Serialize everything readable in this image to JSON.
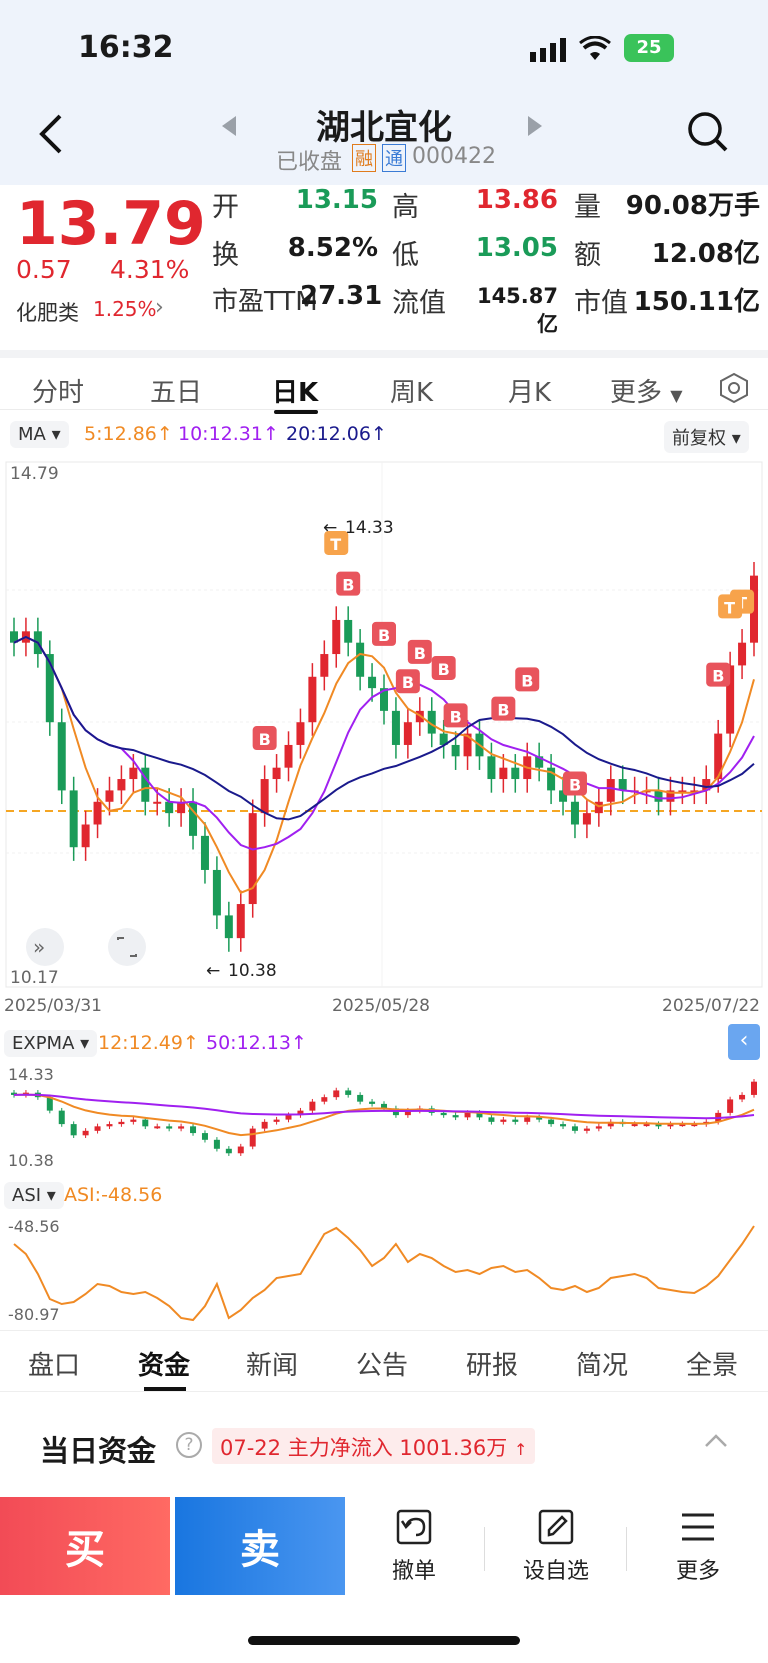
{
  "status_bar": {
    "time": "16:32",
    "battery": "25"
  },
  "header": {
    "title": "湖北宜化",
    "status": "已收盘",
    "badge_rong": "融",
    "badge_tong": "通",
    "code": "000422"
  },
  "quote": {
    "price": "13.79",
    "change": "0.57",
    "change_pct": "4.31%",
    "sector_name": "化肥类",
    "sector_pct": "1.25%",
    "stats": [
      {
        "label": "开",
        "value": "13.15"
      },
      {
        "label": "高",
        "value": "13.86"
      },
      {
        "label": "量",
        "value": "90.08万手"
      },
      {
        "label": "换",
        "value": "8.52%"
      },
      {
        "label": "低",
        "value": "13.05"
      },
      {
        "label": "额",
        "value": "12.08亿"
      },
      {
        "label": "市盈TTM",
        "value": "27.31"
      },
      {
        "label": "流值",
        "value": "145.87亿"
      },
      {
        "label": "市值",
        "value": "150.11亿"
      }
    ]
  },
  "chart_tabs": [
    "分时",
    "五日",
    "日K",
    "周K",
    "月K",
    "更多"
  ],
  "ma_bar": {
    "selector": "MA",
    "ma5": "5:12.86",
    "ma10": "10:12.31",
    "ma20": "20:12.06",
    "adjust": "前复权"
  },
  "kline": {
    "y_max_label": "14.79",
    "y_min_label": "10.17",
    "high_marker": "14.33",
    "low_marker": "10.38",
    "dates": [
      "2025/03/31",
      "2025/05/28",
      "2025/07/22"
    ],
    "b_label": "B",
    "t_label": "T"
  },
  "expma": {
    "selector": "EXPMA",
    "ema12": "12:12.49",
    "ema50": "50:12.13",
    "top_label": "14.33",
    "bottom_label": "10.38"
  },
  "asi": {
    "selector": "ASI",
    "value": "ASI:-48.56",
    "top_label": "-48.56",
    "bottom_label": "-80.97"
  },
  "bottom_tabs": [
    "盘口",
    "资金",
    "新闻",
    "公告",
    "研报",
    "简况",
    "全景"
  ],
  "funds": {
    "title": "当日资金",
    "date": "07-22",
    "text": "主力净流入",
    "amount": "1001.36万"
  },
  "actions": {
    "buy": "买",
    "sell": "卖",
    "cancel": "撤单",
    "watch": "设自选",
    "more": "更多"
  },
  "colors": {
    "up": "#e0272f",
    "down": "#1a9b58",
    "ma5": "#f08a24",
    "ma10": "#a020f0",
    "ma20": "#1a1a8c"
  },
  "chart_data": {
    "type": "candlestick",
    "title": "湖北宜化 日K",
    "dates": [
      "2025/03/31",
      "2025/05/28",
      "2025/07/22"
    ],
    "ylim": [
      10.17,
      14.79
    ],
    "high": 14.33,
    "low": 10.38,
    "last_close": 13.79,
    "series": [
      {
        "name": "MA5",
        "last": 12.86
      },
      {
        "name": "MA10",
        "last": 12.31
      },
      {
        "name": "MA20",
        "last": 12.06
      }
    ],
    "closes": [
      13.2,
      13.3,
      13.1,
      12.5,
      11.9,
      11.4,
      11.6,
      11.8,
      11.9,
      12.0,
      12.1,
      11.8,
      11.8,
      11.7,
      11.8,
      11.5,
      11.2,
      10.8,
      10.6,
      10.9,
      11.7,
      12.0,
      12.1,
      12.3,
      12.5,
      12.9,
      13.1,
      13.4,
      13.2,
      12.9,
      12.8,
      12.6,
      12.3,
      12.5,
      12.6,
      12.4,
      12.3,
      12.2,
      12.4,
      12.2,
      12.0,
      12.1,
      12.0,
      12.2,
      12.1,
      11.9,
      11.8,
      11.6,
      11.7,
      11.8,
      12.0,
      11.9,
      11.9,
      11.9,
      11.8,
      11.9,
      11.9,
      11.9,
      12.0,
      12.4,
      13.0,
      13.2,
      13.79
    ]
  }
}
